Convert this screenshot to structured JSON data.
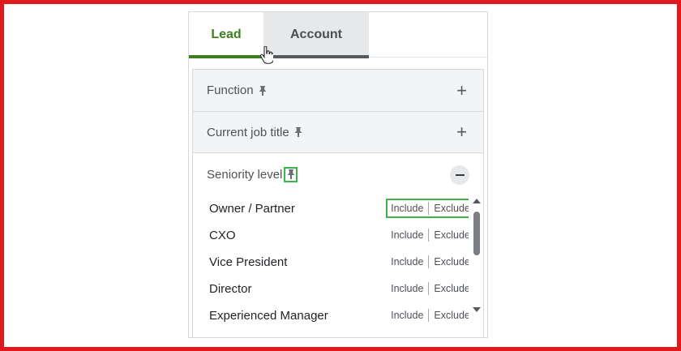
{
  "tabs": {
    "lead": "Lead",
    "account": "Account"
  },
  "filters": {
    "function_label": "Function",
    "current_job_title_label": "Current job title",
    "seniority_label": "Seniority level"
  },
  "seniority_options": [
    {
      "label": "Owner / Partner",
      "include": "Include",
      "exclude": "Exclude"
    },
    {
      "label": "CXO",
      "include": "Include",
      "exclude": "Exclude"
    },
    {
      "label": "Vice President",
      "include": "Include",
      "exclude": "Exclude"
    },
    {
      "label": "Director",
      "include": "Include",
      "exclude": "Exclude"
    },
    {
      "label": "Experienced Manager",
      "include": "Include",
      "exclude": "Exclude"
    }
  ],
  "icons": {
    "pin": "pin-icon",
    "expand": "plus-icon",
    "collapse": "minus-icon",
    "cursor": "hand-cursor-icon"
  },
  "colors": {
    "accent_green": "#3f7e1e",
    "highlight_green": "#3bb54a",
    "frame_red": "#e0191c"
  }
}
